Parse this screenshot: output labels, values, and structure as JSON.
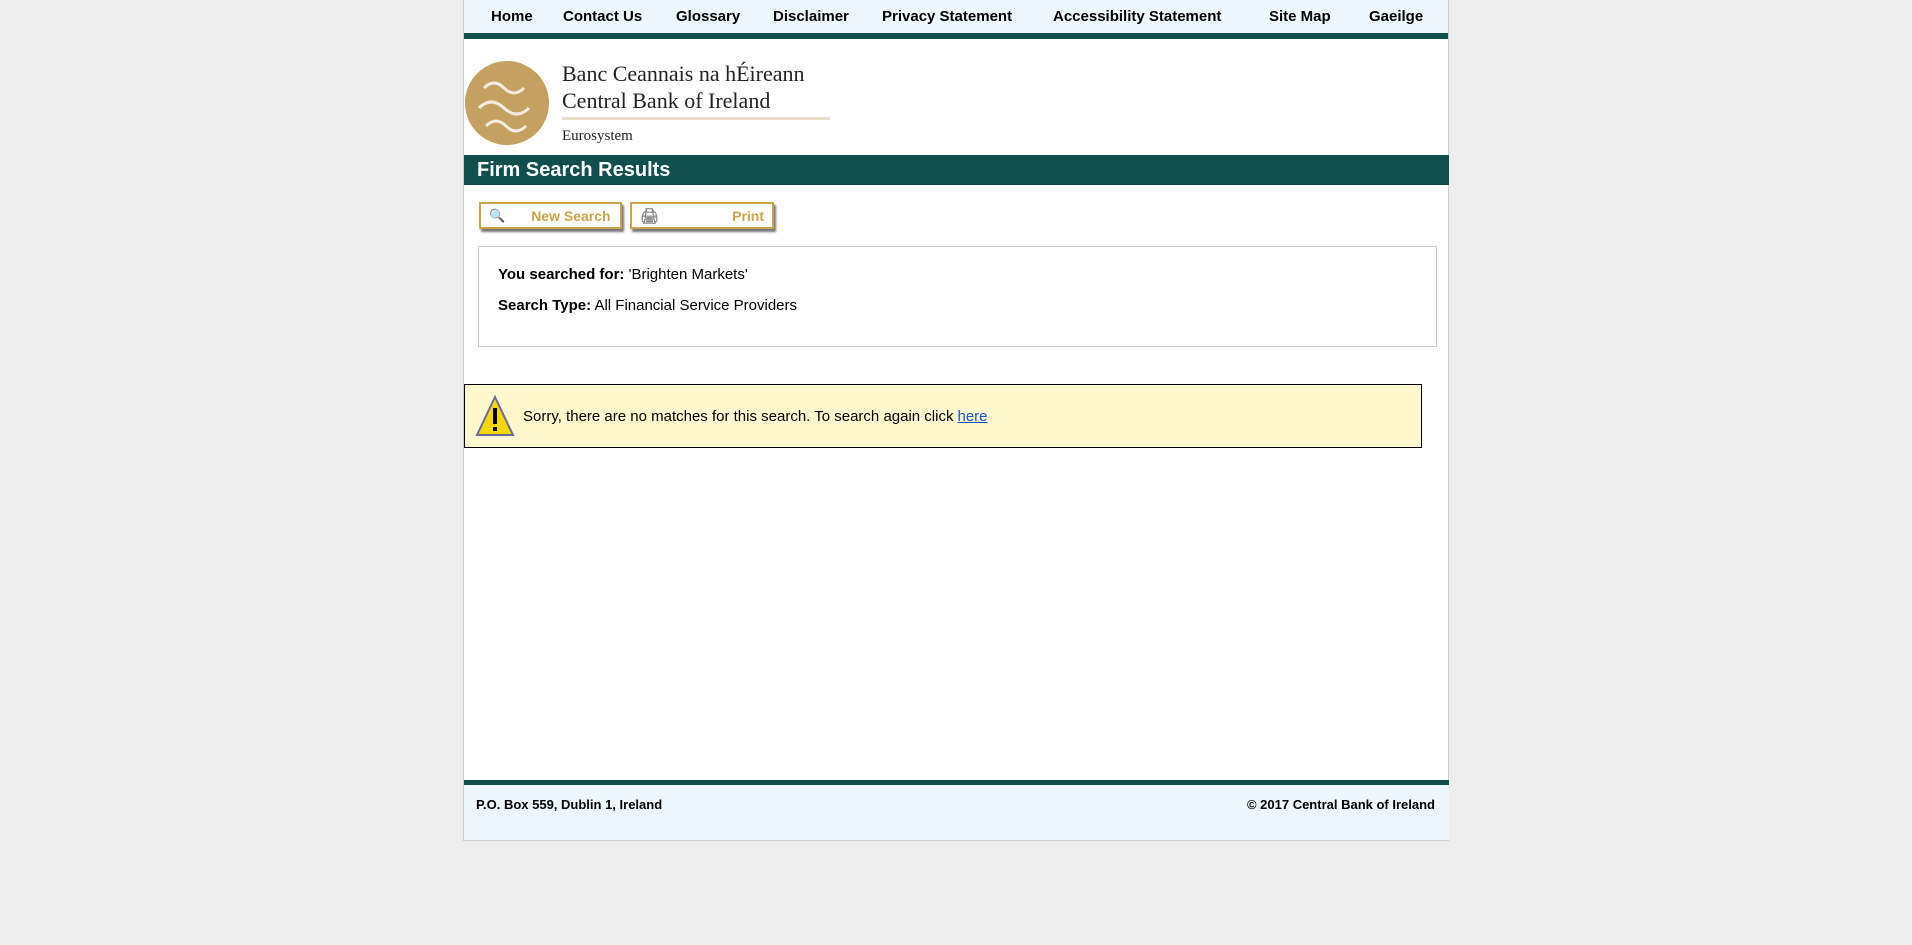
{
  "nav": [
    "Home",
    "Contact Us",
    "Glossary",
    "Disclaimer",
    "Privacy Statement",
    "Accessibility Statement",
    "Site Map",
    "Gaeilge"
  ],
  "logo": {
    "line1": "Banc Ceannais na hÉireann",
    "line2": "Central Bank of Ireland",
    "line3": "Eurosystem"
  },
  "title": "Firm Search Results",
  "buttons": {
    "new_search": "New Search",
    "print": "Print"
  },
  "search": {
    "for_label": "You searched for:",
    "for_value": "'Brighten Markets'",
    "type_label": "Search Type:",
    "type_value": "All Financial Service Providers"
  },
  "warning": {
    "text": "Sorry, there are no matches for this search. To search again click",
    "link": "here"
  },
  "footer": {
    "address": "P.O. Box 559, Dublin 1, Ireland",
    "copyright": "© 2017 Central Bank of Ireland"
  }
}
